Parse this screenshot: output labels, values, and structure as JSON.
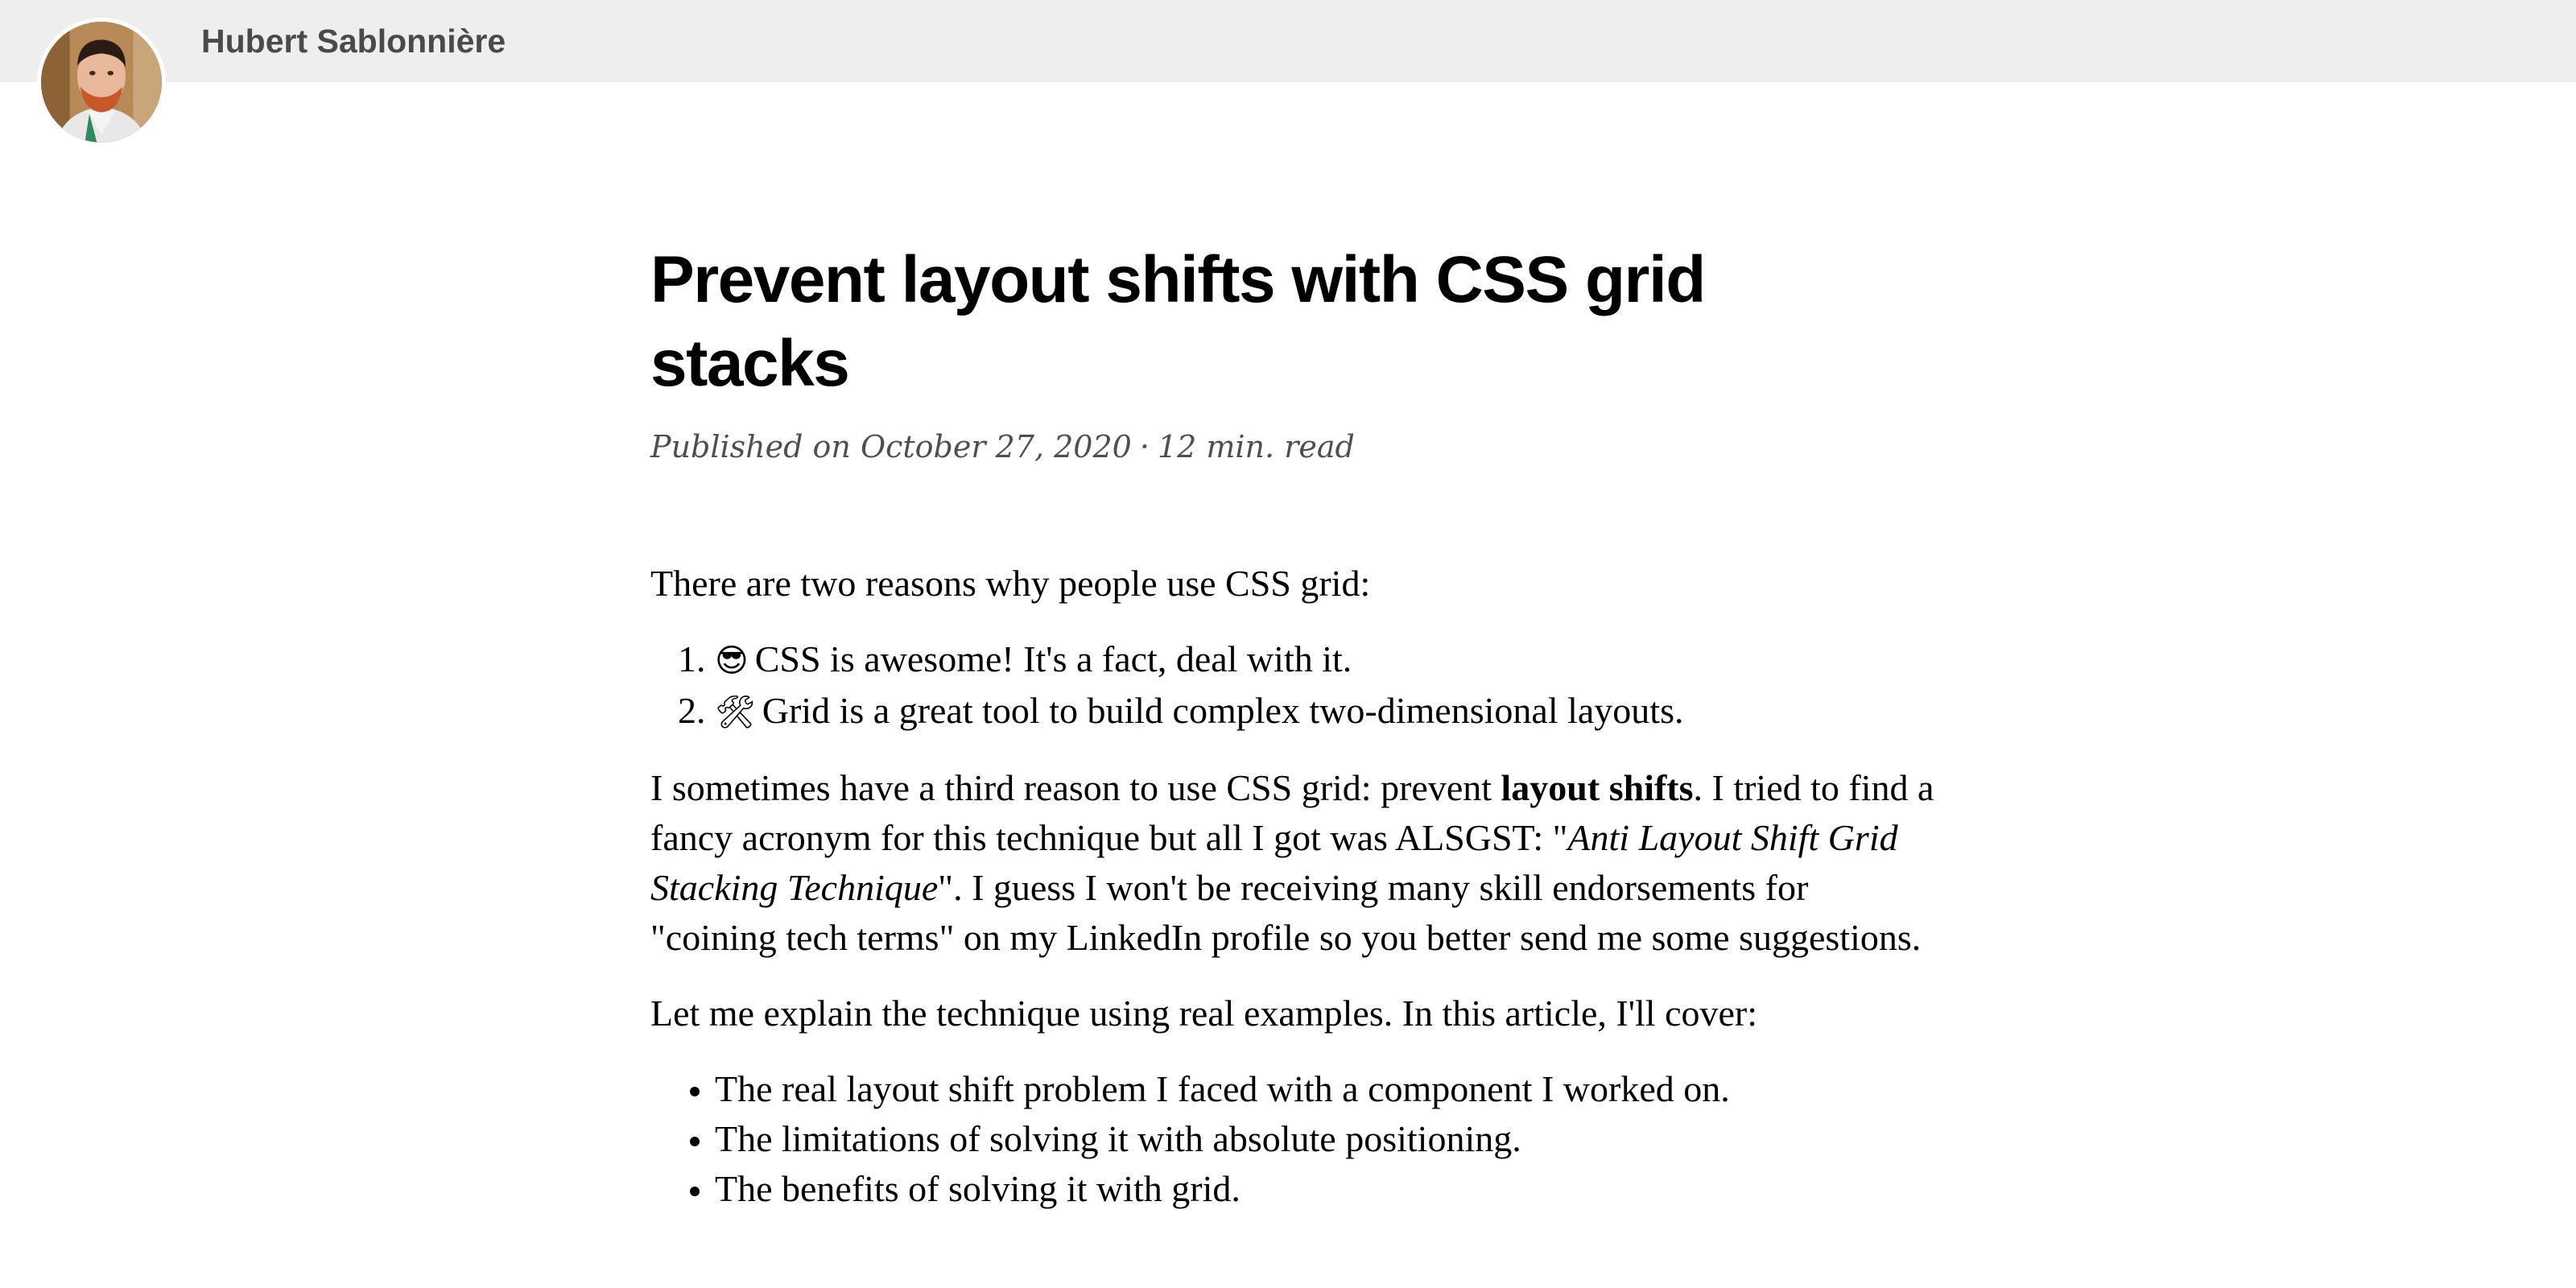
{
  "header": {
    "site_name": "Hubert Sablonnière"
  },
  "article": {
    "title": "Prevent layout shifts with CSS grid stacks",
    "published": "Published on October 27, 2020",
    "separator": "·",
    "read_time": "12 min. read",
    "intro": "There are two reasons why people use CSS grid:",
    "reasons": [
      {
        "icon": "😎",
        "text": "CSS is awesome! It's a fact, deal with it."
      },
      {
        "icon": "🛠",
        "text": "Grid is a great tool to build complex two-dimensional layouts."
      }
    ],
    "third_reason": {
      "before": "I sometimes have a third reason to use CSS grid: prevent ",
      "bold": "layout shifts",
      "middle": ". I tried to find a fancy acronym for this technique but all I got was ALSGST: \"",
      "italic": "Anti Layout Shift Grid Stacking Technique",
      "after": "\". I guess I won't be receiving many skill endorsements for \"coining tech terms\" on my LinkedIn profile so you better send me some suggestions."
    },
    "explain": "Let me explain the technique using real examples. In this article, I'll cover:",
    "topics": [
      "The real layout shift problem I faced with a component I worked on.",
      "The limitations of solving it with absolute positioning.",
      "The benefits of solving it with grid."
    ]
  }
}
